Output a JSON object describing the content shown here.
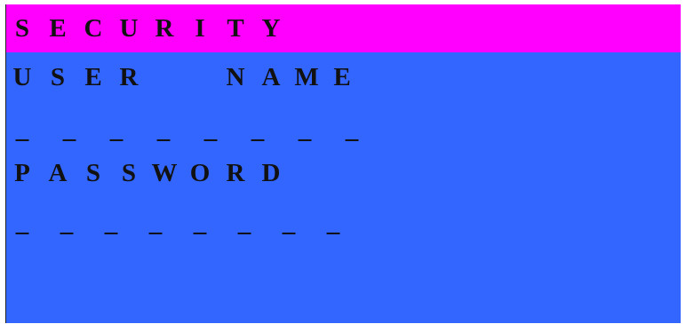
{
  "title": {
    "text": "SECURITY",
    "chars": [
      "S",
      "E",
      "C",
      "U",
      "R",
      "I",
      "T",
      "Y"
    ]
  },
  "user_label": {
    "text": "USER NAME",
    "chars": [
      "U",
      "S",
      "E",
      "R",
      " ",
      "N",
      "A",
      "M",
      "E"
    ]
  },
  "user_field": {
    "value": "________",
    "chars": [
      "_",
      "_",
      "_",
      "_",
      "_",
      "_",
      "_",
      "_"
    ]
  },
  "password_label": {
    "text": "PASSWORD",
    "chars": [
      "P",
      "A",
      "S",
      "S",
      "W",
      "O",
      "R",
      "D"
    ]
  },
  "password_field": {
    "value": "________",
    "chars": [
      "_",
      "_",
      "_",
      "_",
      "_",
      "_",
      "_",
      "_"
    ]
  },
  "colors": {
    "title_background": "#ff00ff",
    "screen_background": "#3366ff",
    "text": "#111111"
  }
}
